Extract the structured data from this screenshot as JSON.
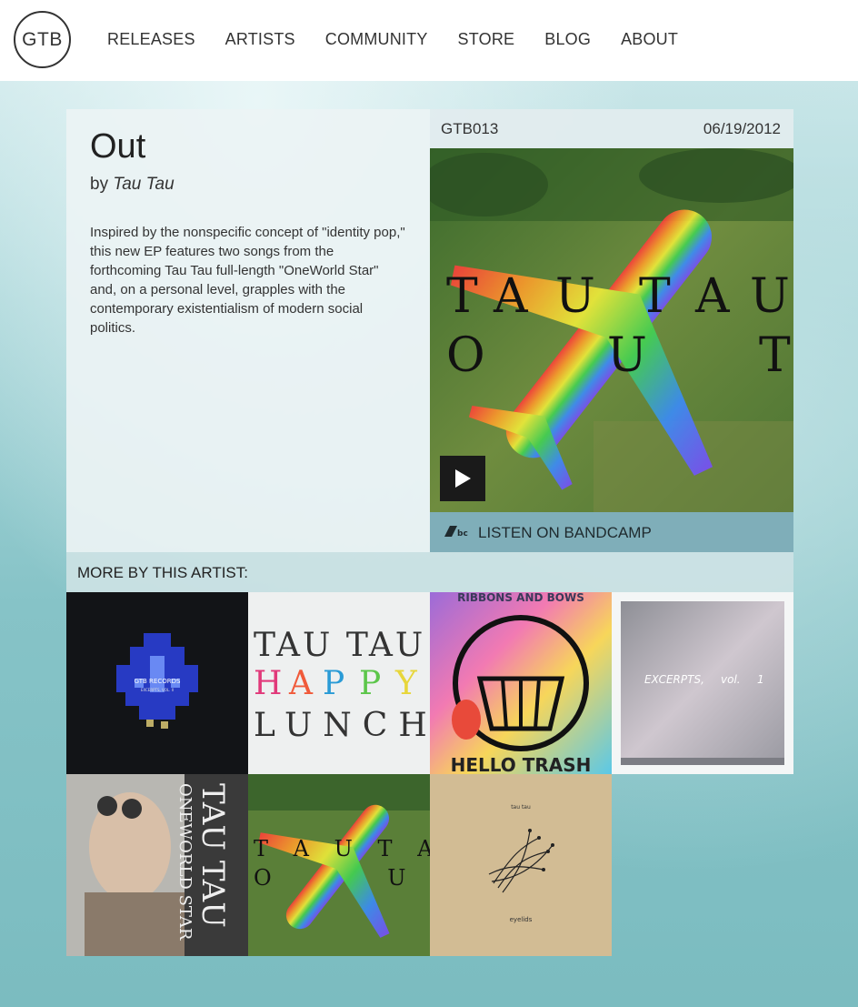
{
  "header": {
    "logo": "GTB",
    "nav": [
      "RELEASES",
      "ARTISTS",
      "COMMUNITY",
      "STORE",
      "BLOG",
      "ABOUT"
    ]
  },
  "release": {
    "title": "Out",
    "by_prefix": "by",
    "artist": "Tau Tau",
    "description": "Inspired by the nonspecific concept of \"identity pop,\" this new EP features two songs from the forthcoming Tau Tau full-length \"OneWorld Star\" and, on a personal level, grapples with the contemporary existentialism of modern social politics.",
    "catalog": "GTB013",
    "date": "06/19/2012",
    "cover_text": [
      "T",
      "A",
      "U",
      "T",
      "A",
      "U",
      "O",
      "U",
      "T"
    ],
    "bandcamp_label": "LISTEN ON BANDCAMP",
    "bandcamp_icon_text": "bc"
  },
  "more": {
    "heading": "MORE BY THIS ARTIST:",
    "tiles": [
      {
        "name": "excerpts-vol-2",
        "lines": [
          "GTB RECORDS",
          "EXCERPTS, VOL. II"
        ]
      },
      {
        "name": "happy-lunch",
        "lines": [
          "TAU TAU",
          "HAPPY",
          "LUNCH"
        ]
      },
      {
        "name": "hello-trash",
        "lines": [
          "RIBBONS AND BOWS",
          "HELLO TRASH"
        ]
      },
      {
        "name": "excerpts-vol-1",
        "lines": [
          "EXCERPTS,",
          "vol.",
          "1"
        ]
      },
      {
        "name": "oneworld-star",
        "lines": [
          "TAU TAU",
          "ONEWORLD STAR"
        ]
      },
      {
        "name": "out",
        "lines": [
          "T A U T A U",
          "O U T"
        ]
      },
      {
        "name": "eyelids",
        "lines": [
          "tau tau",
          "eyelids"
        ]
      }
    ]
  },
  "colors": {
    "bandcamp_bar": "#7faeb9",
    "play_button": "#1a1a1a"
  }
}
